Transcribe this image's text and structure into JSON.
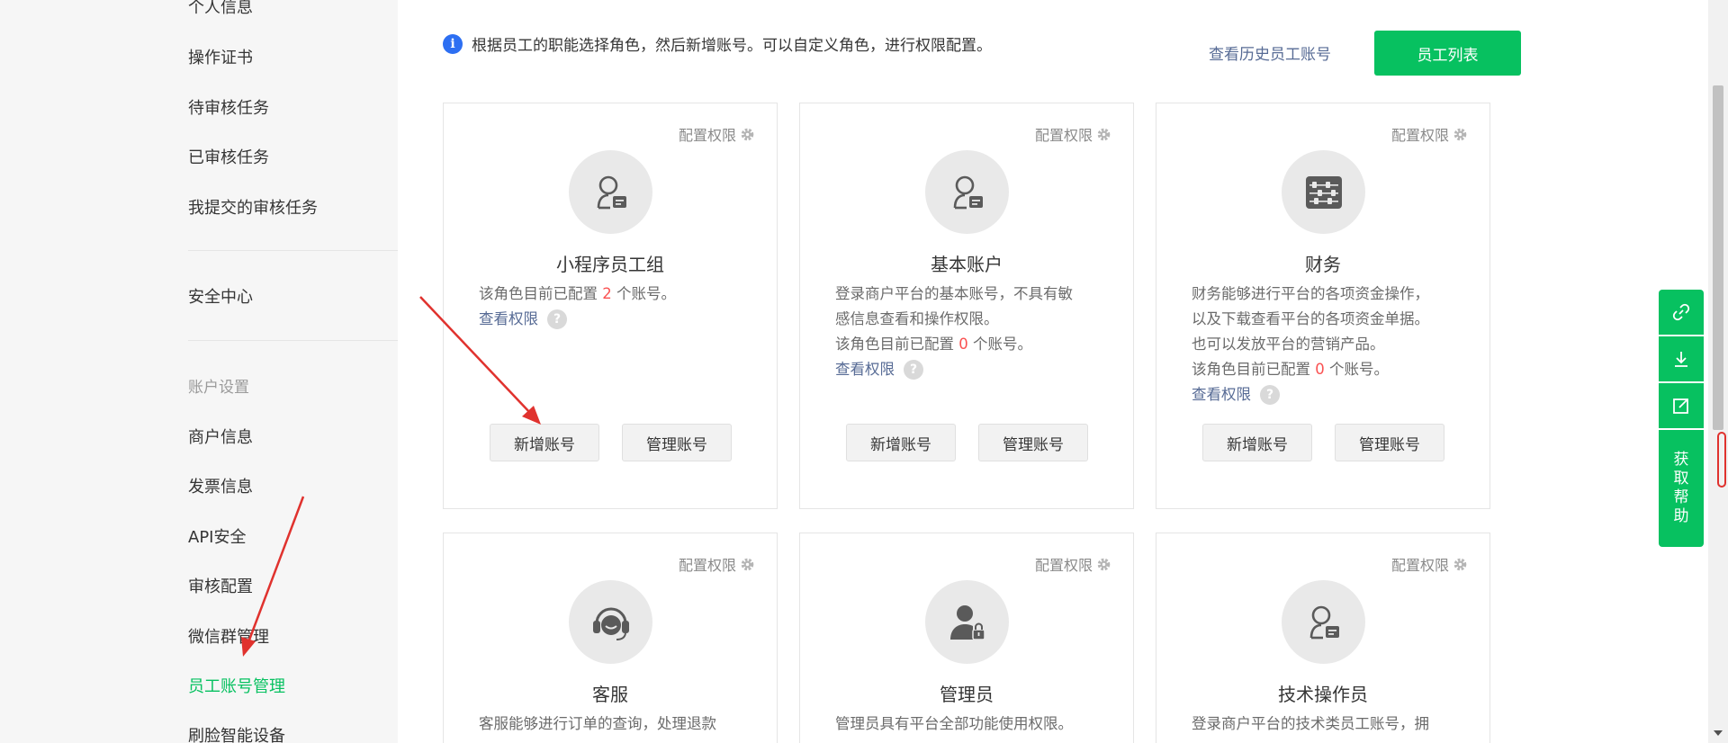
{
  "sidebar": {
    "items_top": [
      "个人信息",
      "操作证书",
      "待审核任务",
      "已审核任务",
      "我提交的审核任务"
    ],
    "security": "安全中心",
    "account_heading": "账户设置",
    "account_items": [
      "商户信息",
      "发票信息",
      "API安全",
      "审核配置",
      "微信群管理",
      "员工账号管理",
      "刷脸智能设备"
    ],
    "active_item": "员工账号管理"
  },
  "notice": {
    "icon": "info-icon",
    "text": "根据员工的职能选择角色，然后新增账号。可以自定义角色，进行权限配置。"
  },
  "header": {
    "history_link": "查看历史员工账号",
    "staff_list_button": "员工列表"
  },
  "cards": [
    {
      "config_label": "配置权限",
      "icon": "user-badge-icon",
      "title": "小程序员工组",
      "desc_lines": [],
      "count_prefix": "该角色目前已配置",
      "count": "2",
      "count_suffix": "个账号。",
      "perm_link": "查看权限",
      "add_button": "新增账号",
      "manage_button": "管理账号"
    },
    {
      "config_label": "配置权限",
      "icon": "user-badge-icon",
      "title": "基本账户",
      "desc_lines": [
        "登录商户平台的基本账号，不具有敏",
        "感信息查看和操作权限。"
      ],
      "count_prefix": "该角色目前已配置",
      "count": "0",
      "count_suffix": "个账号。",
      "perm_link": "查看权限",
      "add_button": "新增账号",
      "manage_button": "管理账号"
    },
    {
      "config_label": "配置权限",
      "icon": "abacus-icon",
      "title": "财务",
      "desc_lines": [
        "财务能够进行平台的各项资金操作，",
        "以及下载查看平台的各项资金单据。",
        "也可以发放平台的营销产品。"
      ],
      "count_prefix": "该角色目前已配置",
      "count": "0",
      "count_suffix": "个账号。",
      "perm_link": "查看权限",
      "add_button": "新增账号",
      "manage_button": "管理账号"
    },
    {
      "config_label": "配置权限",
      "icon": "headset-icon",
      "title": "客服",
      "desc_lines": [
        "客服能够进行订单的查询，处理退款"
      ]
    },
    {
      "config_label": "配置权限",
      "icon": "admin-lock-icon",
      "title": "管理员",
      "desc_lines": [
        "管理员具有平台全部功能使用权限。"
      ]
    },
    {
      "config_label": "配置权限",
      "icon": "user-badge-icon",
      "title": "技术操作员",
      "desc_lines": [
        "登录商户平台的技术类员工账号，拥"
      ]
    }
  ],
  "float_toolbar": {
    "icons": [
      "link-icon",
      "download-icon",
      "edit-icon"
    ],
    "help_chars": [
      "获",
      "取",
      "帮",
      "助"
    ]
  },
  "colors": {
    "accent": "#07c160",
    "link": "#576b95",
    "count": "#fa5151",
    "info": "#2d6ff2",
    "annotation": "#e0322e"
  }
}
